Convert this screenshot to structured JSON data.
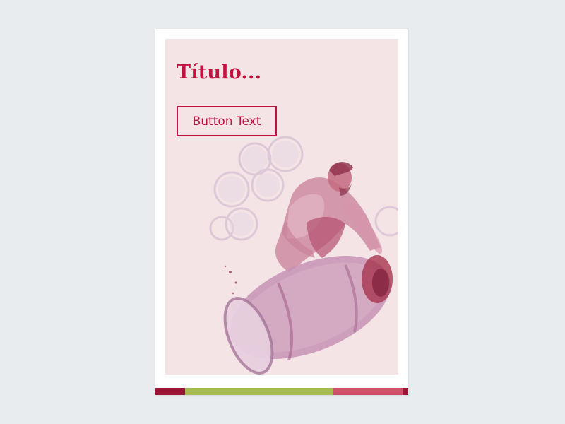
{
  "card": {
    "title": "Título...",
    "button_label": "Button Text"
  },
  "illustration": {
    "subject": "watercolor-man-rolling-wine-barrel"
  },
  "colors": {
    "background": "#e8ecef",
    "panel": "#f4e4e6",
    "accent": "#c2123f",
    "stripe_dark": "#9e1236",
    "stripe_green": "#a6ba52",
    "stripe_rose": "#d4506a"
  }
}
